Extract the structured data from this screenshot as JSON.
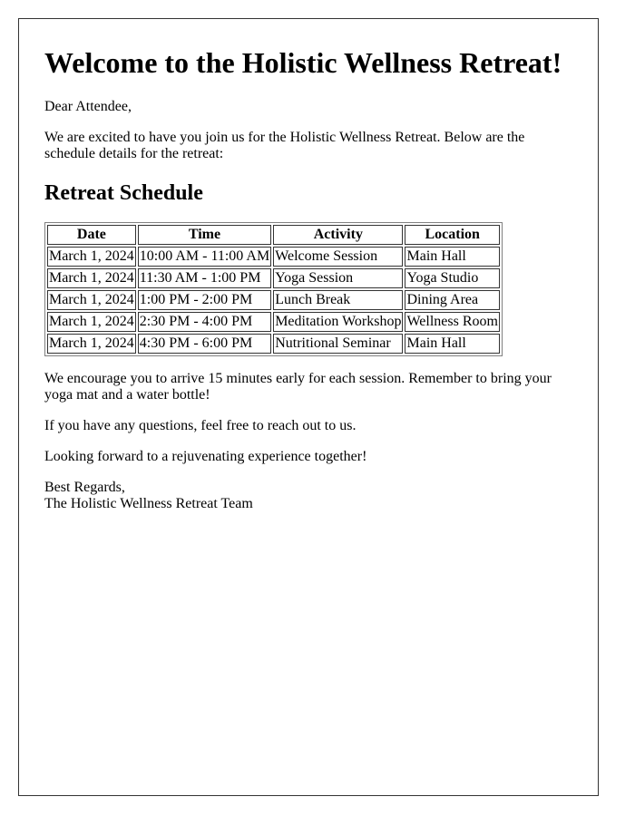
{
  "letter": {
    "title": "Welcome to the Holistic Wellness Retreat!",
    "greeting": "Dear Attendee,",
    "intro": "We are excited to have you join us for the Holistic Wellness Retreat. Below are the schedule details for the retreat:",
    "schedule_heading": "Retreat Schedule",
    "table": {
      "headers": [
        "Date",
        "Time",
        "Activity",
        "Location"
      ],
      "rows": [
        [
          "March 1, 2024",
          "10:00 AM - 11:00 AM",
          "Welcome Session",
          "Main Hall"
        ],
        [
          "March 1, 2024",
          "11:30 AM - 1:00 PM",
          "Yoga Session",
          "Yoga Studio"
        ],
        [
          "March 1, 2024",
          "1:00 PM - 2:00 PM",
          "Lunch Break",
          "Dining Area"
        ],
        [
          "March 1, 2024",
          "2:30 PM - 4:00 PM",
          "Meditation Workshop",
          "Wellness Room"
        ],
        [
          "March 1, 2024",
          "4:30 PM - 6:00 PM",
          "Nutritional Seminar",
          "Main Hall"
        ]
      ]
    },
    "encourage": "We encourage you to arrive 15 minutes early for each session. Remember to bring your yoga mat and a water bottle!",
    "questions": "If you have any questions, feel free to reach out to us.",
    "looking_forward": "Looking forward to a rejuvenating experience together!",
    "closing": "Best Regards,",
    "signature": "The Holistic Wellness Retreat Team"
  }
}
